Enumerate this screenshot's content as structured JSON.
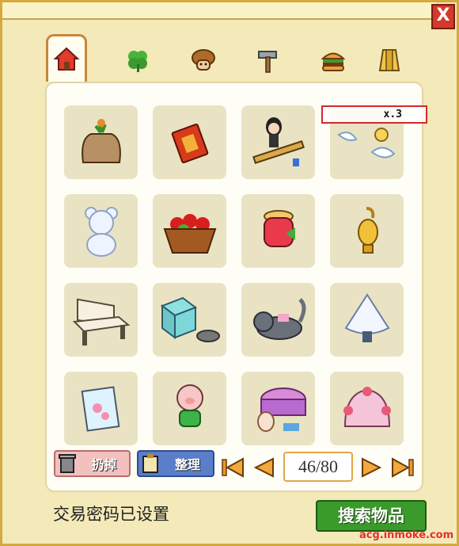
{
  "window": {
    "close_label": "X"
  },
  "tabs": [
    {
      "name": "home",
      "icon": "house-icon",
      "active": true
    },
    {
      "name": "plant",
      "icon": "clover-icon",
      "active": false
    },
    {
      "name": "character",
      "icon": "mushroom-head-icon",
      "active": false
    },
    {
      "name": "tools",
      "icon": "hammer-icon",
      "active": false
    },
    {
      "name": "food",
      "icon": "burger-icon",
      "active": false
    },
    {
      "name": "book",
      "icon": "book-icon",
      "active": false
    }
  ],
  "items": [
    {
      "icon": "seed-sack-icon"
    },
    {
      "icon": "red-coupon-icon"
    },
    {
      "icon": "girl-on-bench-icon"
    },
    {
      "icon": "angel-wings-icon",
      "quantity": "x.3"
    },
    {
      "icon": "snow-bear-icon"
    },
    {
      "icon": "fruit-basket-icon"
    },
    {
      "icon": "jam-jar-icon"
    },
    {
      "icon": "gold-lamp-icon"
    },
    {
      "icon": "white-bench-icon"
    },
    {
      "icon": "gift-box-cat-icon"
    },
    {
      "icon": "gray-cat-icon"
    },
    {
      "icon": "snow-tree-icon"
    },
    {
      "icon": "flower-painting-icon"
    },
    {
      "icon": "pig-icon"
    },
    {
      "icon": "bunny-cake-icon"
    },
    {
      "icon": "flower-dome-icon"
    }
  ],
  "actions": {
    "discard_label": "扔掉",
    "sort_label": "整理"
  },
  "pager": {
    "current": "46",
    "total": "80",
    "display": "46/80"
  },
  "status_text": "交易密码已设置",
  "search_button": "搜索物品",
  "watermark": "acg.inmoke.com",
  "colors": {
    "frame": "#f4e9b8",
    "accent_gold": "#d4a93e",
    "close_red": "#d33a2c",
    "search_green": "#3a9a2a",
    "tab_border": "#c7863a"
  }
}
